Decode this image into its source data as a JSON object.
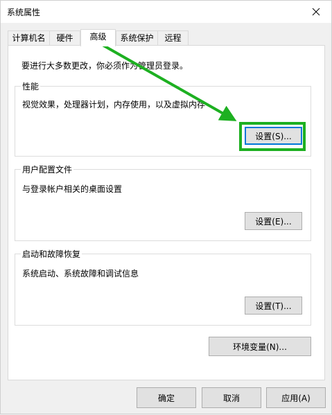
{
  "window": {
    "title": "系统属性"
  },
  "tabs": [
    {
      "label": "计算机名"
    },
    {
      "label": "硬件"
    },
    {
      "label": "高级"
    },
    {
      "label": "系统保护"
    },
    {
      "label": "远程"
    }
  ],
  "active_tab": "高级",
  "admin_note": "要进行大多数更改，你必须作为管理员登录。",
  "performance": {
    "title": "性能",
    "description": "视觉效果，处理器计划，内存使用，以及虚拟内存",
    "button_label": "设置(S)..."
  },
  "user_profiles": {
    "title": "用户配置文件",
    "description": "与登录帐户相关的桌面设置",
    "button_label": "设置(E)..."
  },
  "startup_recovery": {
    "title": "启动和故障恢复",
    "description": "系统启动、系统故障和调试信息",
    "button_label": "设置(T)..."
  },
  "env_vars_button": "环境变量(N)...",
  "footer": {
    "ok": "确定",
    "cancel": "取消",
    "apply": "应用(A)"
  },
  "colors": {
    "highlight": "#1db021",
    "focus_border": "#0078d7"
  },
  "icons": {
    "close": "close-icon",
    "annotation": "green-arrow-icon"
  }
}
